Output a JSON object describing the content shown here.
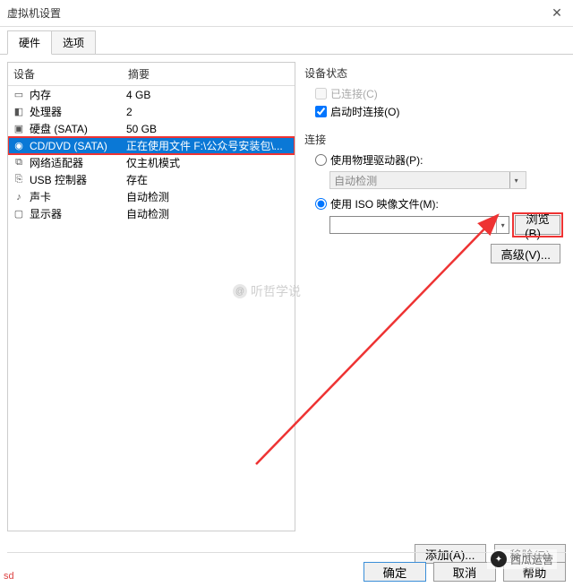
{
  "window": {
    "title": "虚拟机设置"
  },
  "tabs": {
    "hardware": "硬件",
    "options": "选项"
  },
  "list": {
    "header_device": "设备",
    "header_summary": "摘要",
    "rows": [
      {
        "icon": "memory-icon",
        "name": "内存",
        "summary": "4 GB"
      },
      {
        "icon": "cpu-icon",
        "name": "处理器",
        "summary": "2"
      },
      {
        "icon": "disk-icon",
        "name": "硬盘 (SATA)",
        "summary": "50 GB"
      },
      {
        "icon": "cd-icon",
        "name": "CD/DVD (SATA)",
        "summary": "正在使用文件 F:\\公众号安装包\\..."
      },
      {
        "icon": "network-icon",
        "name": "网络适配器",
        "summary": "仅主机模式"
      },
      {
        "icon": "usb-icon",
        "name": "USB 控制器",
        "summary": "存在"
      },
      {
        "icon": "sound-icon",
        "name": "声卡",
        "summary": "自动检测"
      },
      {
        "icon": "display-icon",
        "name": "显示器",
        "summary": "自动检测"
      }
    ]
  },
  "right": {
    "status_title": "设备状态",
    "connected_label": "已连接(C)",
    "poweron_label": "启动时连接(O)",
    "connection_title": "连接",
    "physical_label": "使用物理驱动器(P):",
    "physical_value": "自动检测",
    "iso_label": "使用 ISO 映像文件(M):",
    "iso_value": "",
    "browse_button": "浏览(B)...",
    "advanced_button": "高级(V)..."
  },
  "left_buttons": {
    "add": "添加(A)...",
    "remove": "移除(R)"
  },
  "footer": {
    "ok": "确定",
    "cancel": "取消",
    "help": "帮助"
  },
  "watermark": "听哲学说",
  "brand": "西瓜运营",
  "sd": "sd"
}
